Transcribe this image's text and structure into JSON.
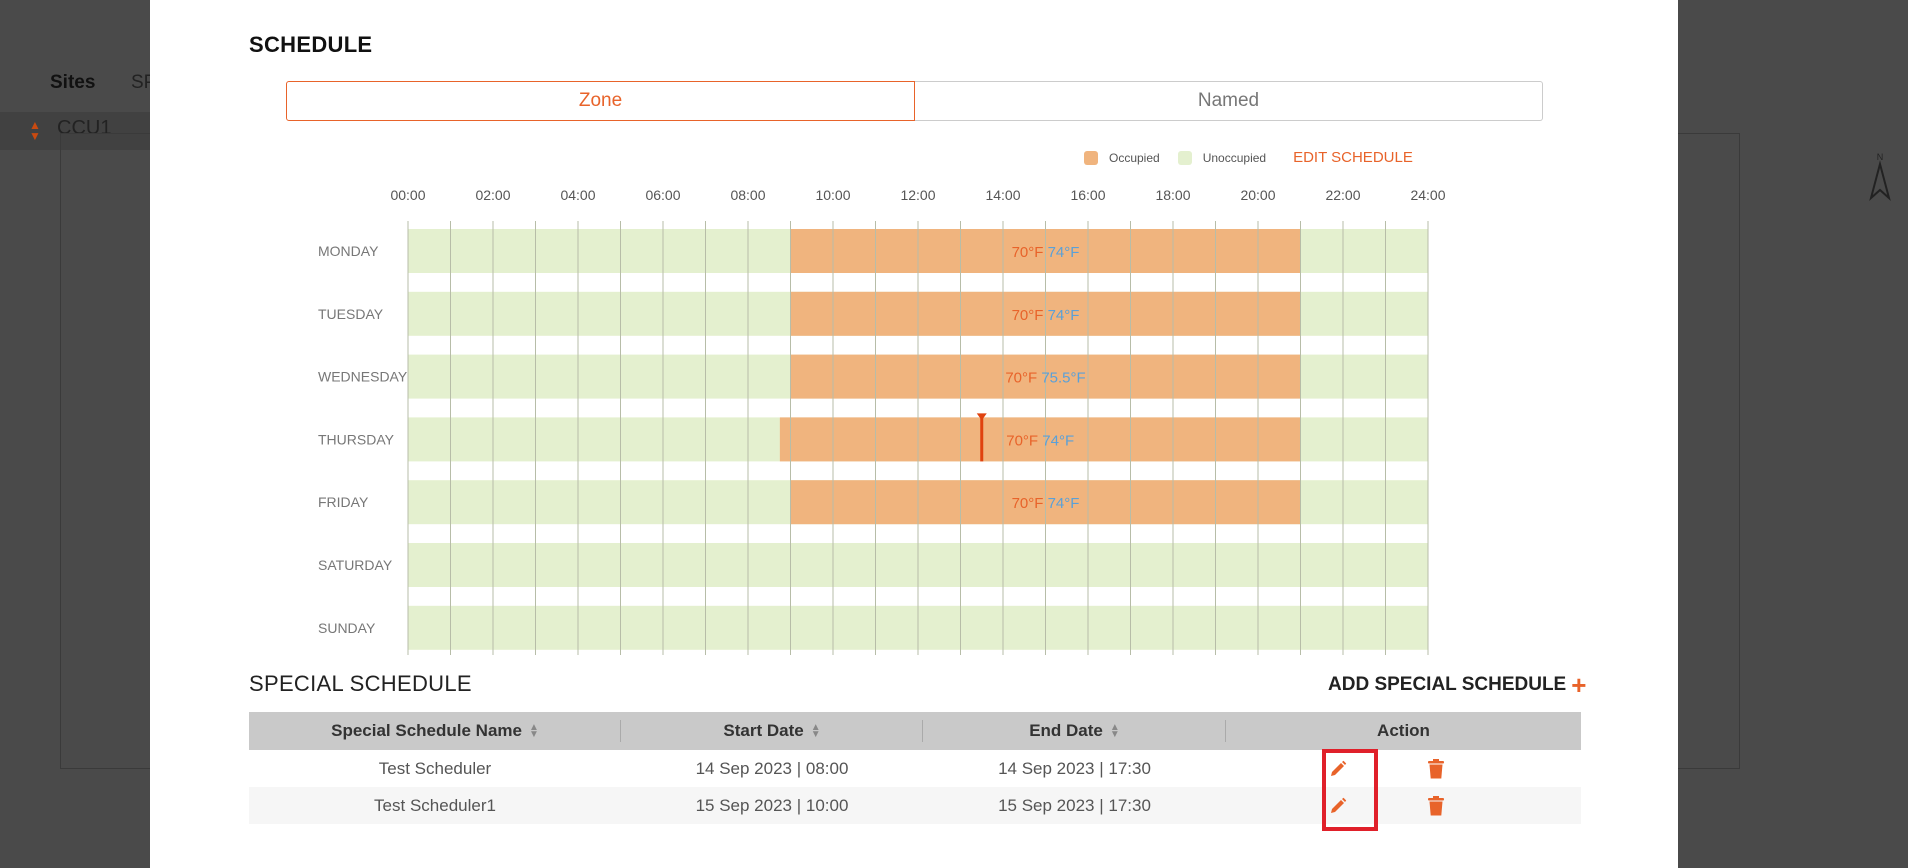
{
  "background": {
    "tabs": [
      "Sites",
      "SP"
    ],
    "ccu_label": "CCU1"
  },
  "modal": {
    "title": "SCHEDULE",
    "tabs": [
      {
        "label": "Zone",
        "active": true
      },
      {
        "label": "Named",
        "active": false
      }
    ],
    "legend": {
      "occupied_label": "Occupied",
      "occupied_color": "#f0b47e",
      "unoccupied_label": "Unoccupied",
      "unoccupied_color": "#e4f0cf",
      "edit_label": "EDIT SCHEDULE"
    }
  },
  "chart_data": {
    "type": "gantt",
    "x_ticks": [
      "00:00",
      "02:00",
      "04:00",
      "06:00",
      "08:00",
      "10:00",
      "12:00",
      "14:00",
      "16:00",
      "18:00",
      "20:00",
      "22:00",
      "24:00"
    ],
    "x_range_hours": [
      0,
      24
    ],
    "days": [
      {
        "day": "MONDAY",
        "occupied": [
          {
            "start": 9.0,
            "end": 21.0,
            "heat": "70°F",
            "cool": "74°F"
          }
        ]
      },
      {
        "day": "TUESDAY",
        "occupied": [
          {
            "start": 9.0,
            "end": 21.0,
            "heat": "70°F",
            "cool": "74°F"
          }
        ]
      },
      {
        "day": "WEDNESDAY",
        "occupied": [
          {
            "start": 9.0,
            "end": 21.0,
            "heat": "70°F",
            "cool": "75.5°F"
          }
        ]
      },
      {
        "day": "THURSDAY",
        "occupied": [
          {
            "start": 8.75,
            "end": 21.0,
            "heat": "70°F",
            "cool": "74°F"
          }
        ],
        "current_time": 13.5
      },
      {
        "day": "FRIDAY",
        "occupied": [
          {
            "start": 9.0,
            "end": 21.0,
            "heat": "70°F",
            "cool": "74°F"
          }
        ]
      },
      {
        "day": "SATURDAY",
        "occupied": []
      },
      {
        "day": "SUNDAY",
        "occupied": []
      }
    ],
    "colors": {
      "occupied": "#f0b47e",
      "unoccupied": "#e4f0cf",
      "heat": "#e8632a",
      "cool": "#5aa0d8",
      "now_marker": "#e0420f"
    }
  },
  "special": {
    "title": "SPECIAL SCHEDULE",
    "add_label": "ADD SPECIAL SCHEDULE",
    "add_icon": "+",
    "columns": [
      "Special Schedule Name",
      "Start Date",
      "End Date",
      "Action"
    ],
    "rows": [
      {
        "name": "Test Scheduler",
        "start": "14 Sep 2023 | 08:00",
        "end": "14 Sep 2023 | 17:30"
      },
      {
        "name": "Test Scheduler1",
        "start": "15 Sep 2023 | 10:00",
        "end": "15 Sep 2023 | 17:30"
      }
    ],
    "icons": {
      "edit": "pencil-icon",
      "delete": "trash-icon"
    }
  }
}
